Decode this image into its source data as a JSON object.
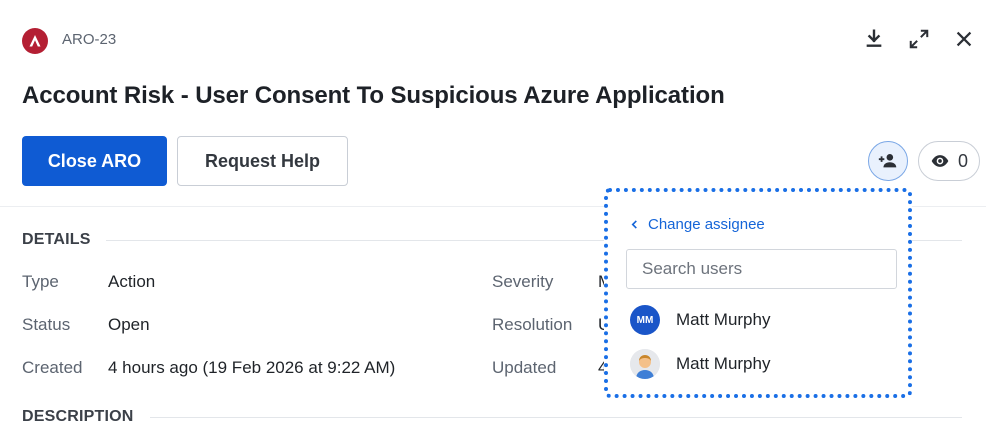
{
  "header": {
    "ticket_id": "ARO-23",
    "title": "Account Risk - User Consent To Suspicious Azure Application",
    "logo_icon": "brand-a-icon",
    "actions": [
      "download-icon",
      "expand-icon",
      "close-icon"
    ]
  },
  "toolbar": {
    "primary_label": "Close ARO",
    "secondary_label": "Request Help",
    "watchers_count": "0"
  },
  "details": {
    "heading": "DETAILS",
    "left": [
      {
        "label": "Type",
        "value": "Action"
      },
      {
        "label": "Status",
        "value": "Open"
      },
      {
        "label": "Created",
        "value": "4 hours ago (19 Feb 2026 at 9:22 AM)"
      }
    ],
    "right": [
      {
        "label": "Severity",
        "value": "M"
      },
      {
        "label": "Resolution",
        "value": "U"
      },
      {
        "label": "Updated",
        "value": "4"
      }
    ]
  },
  "description": {
    "heading": "DESCRIPTION"
  },
  "assignee_dropdown": {
    "back_label": "Change assignee",
    "search_placeholder": "Search users",
    "users": [
      {
        "initials": "MM",
        "name": "Matt Murphy",
        "avatar": "initials"
      },
      {
        "name": "Matt Murphy",
        "avatar": "person-avatar-icon"
      }
    ]
  },
  "colors": {
    "primary": "#0f5bd3",
    "brand": "#b41f33",
    "link": "#1565d8",
    "focus_outline": "#1a6fe6"
  }
}
